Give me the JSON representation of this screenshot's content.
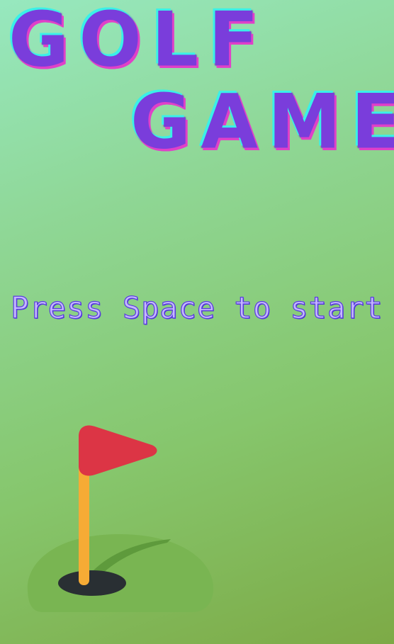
{
  "game": {
    "title_line_1": "GOLF",
    "title_line_2": "GAME",
    "start_prompt": "Press Space to start"
  },
  "colors": {
    "title_fill": "#7a3ddb",
    "title_glow_cyan": "#3af0e8",
    "title_glow_magenta": "#e040c8",
    "prompt_fill": "#c6b8ff",
    "prompt_outline": "#5a3ce0",
    "flag_red": "#dc3545",
    "flag_pole": "#f6ab35",
    "green_mound": "#79b552",
    "green_shade": "#5e9a3c",
    "hole_dark": "#292f33"
  },
  "icons": {
    "hole": "golf-flag-in-hole-icon"
  }
}
